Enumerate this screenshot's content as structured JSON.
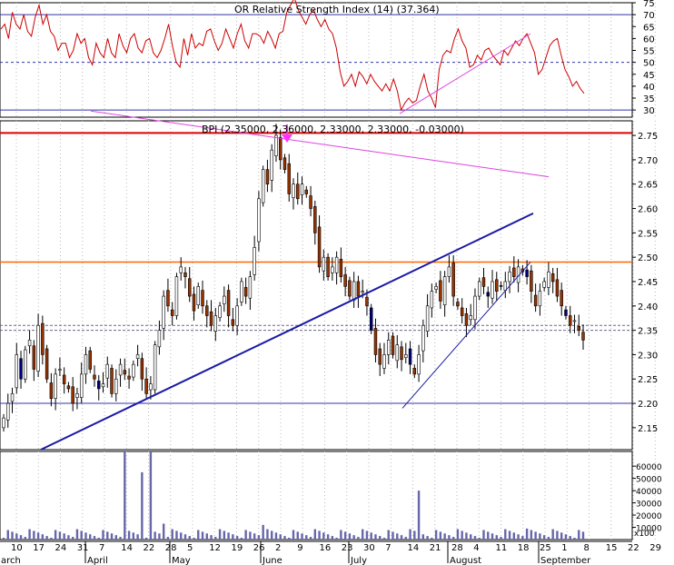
{
  "colors": {
    "rsi_line": "#cc0000",
    "hline_red": "#dd0000",
    "hline_orange": "#ff6600",
    "hline_blue": "#3333aa",
    "trend_blue": "#1a1aa6",
    "trend_magenta": "#dd44dd",
    "candle_up": "#ffffff",
    "candle_down": "#993300",
    "candle_down_alt": "#000080",
    "volume": "#6666aa",
    "grid": "#bbbbbb",
    "arrow": "#ff33ff"
  },
  "chart_data": [
    {
      "type": "line",
      "title": "OR Relative Strength Index (14) (37.364)",
      "ylim": [
        27,
        75
      ],
      "yticks": [
        30,
        35,
        40,
        45,
        50,
        55,
        60,
        65,
        70,
        75
      ],
      "reference_lines": [
        70,
        50,
        30
      ],
      "values": [
        64,
        66,
        60,
        71,
        66,
        64,
        70,
        63,
        61,
        69,
        74,
        66,
        70,
        63,
        61,
        55,
        58,
        58,
        52,
        55,
        62,
        58,
        60,
        52,
        49,
        58,
        54,
        52,
        60,
        54,
        52,
        62,
        57,
        54,
        60,
        62,
        56,
        54,
        59,
        60,
        54,
        52,
        55,
        60,
        66,
        57,
        50,
        48,
        60,
        53,
        62,
        56,
        58,
        57,
        63,
        64,
        59,
        55,
        58,
        64,
        60,
        56,
        62,
        66,
        59,
        56,
        62,
        62,
        61,
        58,
        63,
        60,
        56,
        62,
        63,
        71,
        74,
        77,
        72,
        69,
        66,
        70,
        72,
        68,
        65,
        68,
        64,
        62,
        56,
        46,
        40,
        42,
        45,
        40,
        46,
        44,
        41,
        45,
        42,
        40,
        38,
        41,
        38,
        43,
        38,
        30,
        33,
        35,
        33,
        34,
        40,
        45,
        38,
        35,
        31,
        47,
        53,
        55,
        54,
        60,
        64,
        59,
        56,
        48,
        49,
        53,
        51,
        55,
        56,
        53,
        51,
        49,
        55,
        53,
        56,
        59,
        57,
        60,
        62,
        58,
        54,
        45,
        47,
        52,
        57,
        59,
        60,
        53,
        47,
        44,
        40,
        42,
        39,
        37
      ]
    },
    {
      "type": "candlestick",
      "title": "BPI (2.35000, 2.36000, 2.33000, 2.33000, -0.03000)",
      "ylim": [
        2.105,
        2.78
      ],
      "yticks": [
        2.15,
        2.2,
        2.25,
        2.3,
        2.35,
        2.4,
        2.45,
        2.5,
        2.55,
        2.6,
        2.65,
        2.7,
        2.75
      ],
      "horizontal_lines": [
        {
          "value": 2.755,
          "color": "red"
        },
        {
          "value": 2.49,
          "color": "orange"
        },
        {
          "value": 2.2,
          "color": "blue"
        },
        {
          "value": 2.36,
          "style": "dashed"
        },
        {
          "value": 2.35,
          "style": "dashed"
        }
      ],
      "close": [
        2.17,
        2.2,
        2.22,
        2.3,
        2.25,
        2.31,
        2.33,
        2.27,
        2.36,
        2.3,
        2.25,
        2.21,
        2.26,
        2.27,
        2.24,
        2.23,
        2.2,
        2.22,
        2.26,
        2.3,
        2.27,
        2.25,
        2.23,
        2.24,
        2.28,
        2.22,
        2.25,
        2.28,
        2.26,
        2.25,
        2.28,
        2.3,
        2.25,
        2.22,
        2.24,
        2.32,
        2.35,
        2.42,
        2.4,
        2.38,
        2.46,
        2.48,
        2.46,
        2.42,
        2.39,
        2.44,
        2.4,
        2.38,
        2.36,
        2.38,
        2.4,
        2.42,
        2.38,
        2.36,
        2.4,
        2.45,
        2.42,
        2.46,
        2.52,
        2.62,
        2.68,
        2.65,
        2.72,
        2.75,
        2.7,
        2.68,
        2.63,
        2.65,
        2.62,
        2.65,
        2.63,
        2.6,
        2.55,
        2.48,
        2.5,
        2.46,
        2.48,
        2.5,
        2.46,
        2.44,
        2.42,
        2.45,
        2.42,
        2.43,
        2.4,
        2.35,
        2.3,
        2.28,
        2.3,
        2.33,
        2.3,
        2.32,
        2.29,
        2.3,
        2.28,
        2.26,
        2.3,
        2.36,
        2.4,
        2.43,
        2.44,
        2.41,
        2.46,
        2.48,
        2.42,
        2.4,
        2.38,
        2.36,
        2.38,
        2.42,
        2.45,
        2.44,
        2.42,
        2.45,
        2.43,
        2.44,
        2.45,
        2.47,
        2.46,
        2.48,
        2.47,
        2.46,
        2.43,
        2.4,
        2.43,
        2.45,
        2.47,
        2.45,
        2.42,
        2.4,
        2.38,
        2.36,
        2.37,
        2.35,
        2.33
      ],
      "trendlines": [
        {
          "color": "blue",
          "width": "thick",
          "from": [
            "Mar-8",
            2.105
          ],
          "to": [
            "Aug-31",
            2.59
          ]
        },
        {
          "color": "blue",
          "width": "thin",
          "from": [
            "Jul-20",
            2.19
          ],
          "to": [
            "Aug-30",
            2.49
          ]
        },
        {
          "color": "magenta",
          "from": [
            "Mar-31",
            2.8
          ],
          "to": [
            "Sep-15",
            2.665
          ]
        }
      ],
      "annotation": "magenta down-arrow at June 9 peak"
    },
    {
      "type": "bar",
      "title": "Volume",
      "ylim": [
        0,
        72000
      ],
      "yticks": [
        10000,
        20000,
        30000,
        40000,
        50000,
        60000
      ],
      "ytick_labels": [
        "10000",
        "20000",
        "30000",
        "40000",
        "50000",
        "60000"
      ],
      "unit_label": "x100",
      "spikes": [
        {
          "date": "Apr-14",
          "value": 72000
        },
        {
          "date": "Apr-21",
          "value": 55000
        },
        {
          "date": "Apr-23",
          "value": 72000
        },
        {
          "date": "Jul-21",
          "value": 40000
        },
        {
          "date": "Apr-26",
          "value": 13000
        },
        {
          "date": "Jun-2",
          "value": 12000
        },
        {
          "date": "Aug-26",
          "value": 9000
        }
      ]
    }
  ],
  "x_axis": {
    "day_ticks": [
      "10",
      "17",
      "24",
      "31",
      "7",
      "14",
      "22",
      "28",
      "5",
      "12",
      "19",
      "26",
      "2",
      "9",
      "16",
      "23",
      "30",
      "7",
      "14",
      "21",
      "28",
      "4",
      "11",
      "18",
      "25",
      "1",
      "8",
      "15",
      "22",
      "29"
    ],
    "month_labels": [
      "arch",
      "April",
      "May",
      "June",
      "July",
      "August",
      "September"
    ]
  }
}
